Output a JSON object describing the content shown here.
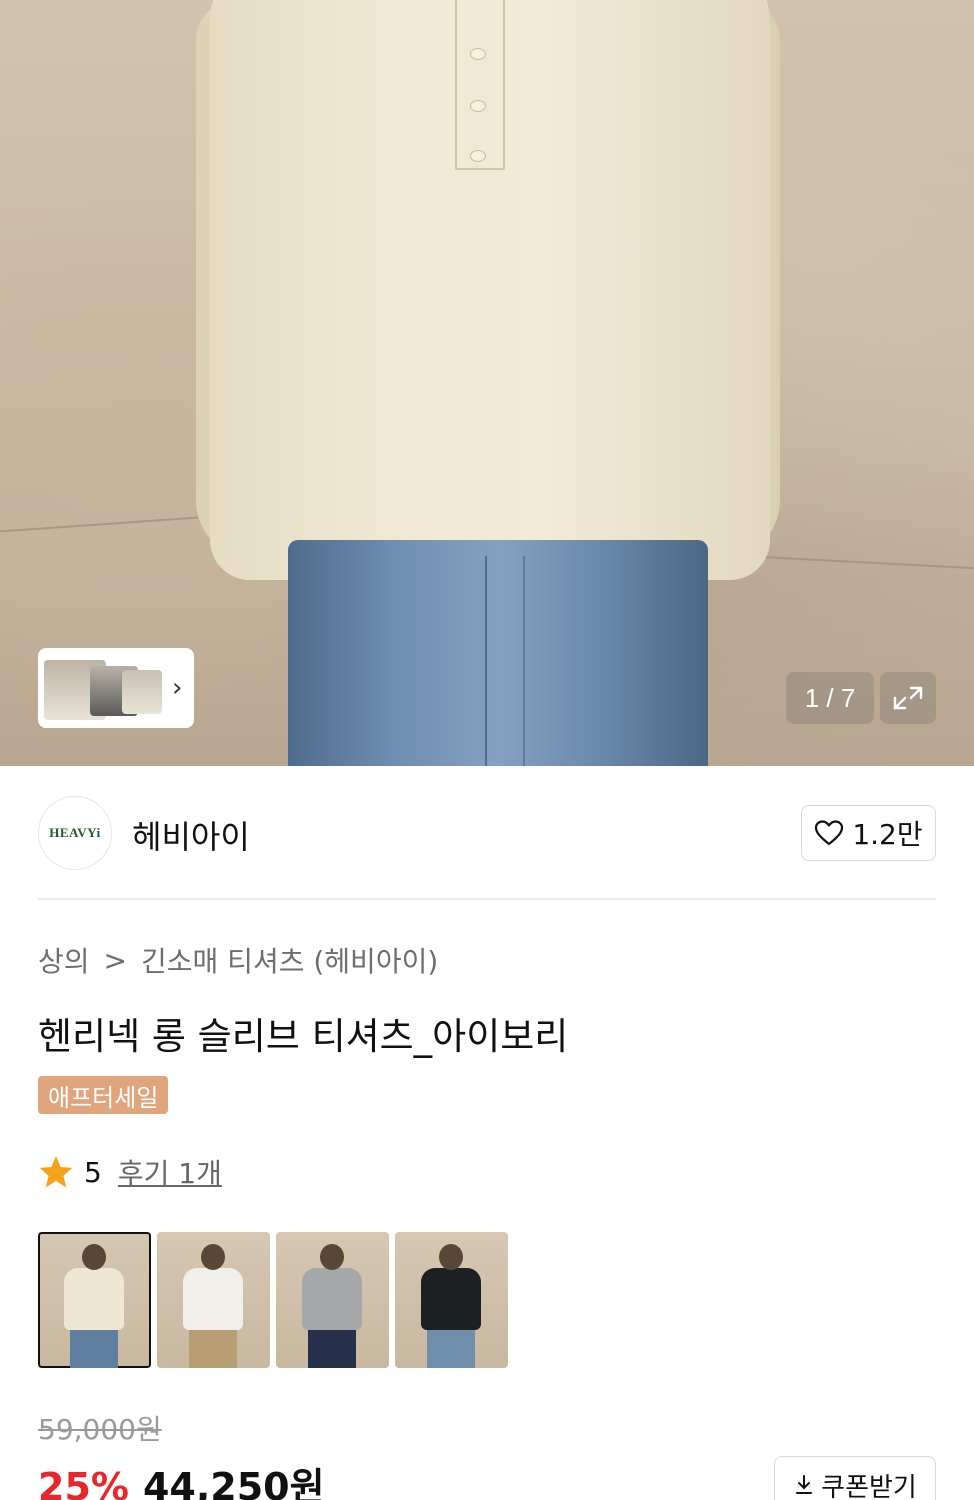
{
  "gallery": {
    "counter": "1 / 7",
    "current": 1,
    "total": 7
  },
  "brand": {
    "logo_text": "HEAVYi",
    "name": "헤비아이",
    "likes": "1.2만"
  },
  "breadcrumb": {
    "category": "상의",
    "separator": ">",
    "subcategory": "긴소매 티셔츠",
    "brand_tag": "(헤비아이)"
  },
  "product": {
    "title": "헨리넥 롱 슬리브 티셔츠_아이보리",
    "badge": "애프터세일"
  },
  "rating": {
    "score": "5",
    "reviews": "후기 1개"
  },
  "color_options": [
    {
      "name": "ivory",
      "shirt": "#efe7d2",
      "legs": "#5f7ea0"
    },
    {
      "name": "white",
      "shirt": "#f1efe9",
      "legs": "#b79e73"
    },
    {
      "name": "grey",
      "shirt": "#a6a7a8",
      "legs": "#27304a"
    },
    {
      "name": "black",
      "shirt": "#1d1f22",
      "legs": "#6f8eac"
    }
  ],
  "pricing": {
    "original": "59,000원",
    "discount": "25%",
    "sale": "44,250원"
  },
  "coupon": {
    "label": "쿠폰받기"
  },
  "colors": {
    "accent_red": "#e8262b",
    "badge_bg": "#e0a57c",
    "star": "#f5a21a"
  }
}
